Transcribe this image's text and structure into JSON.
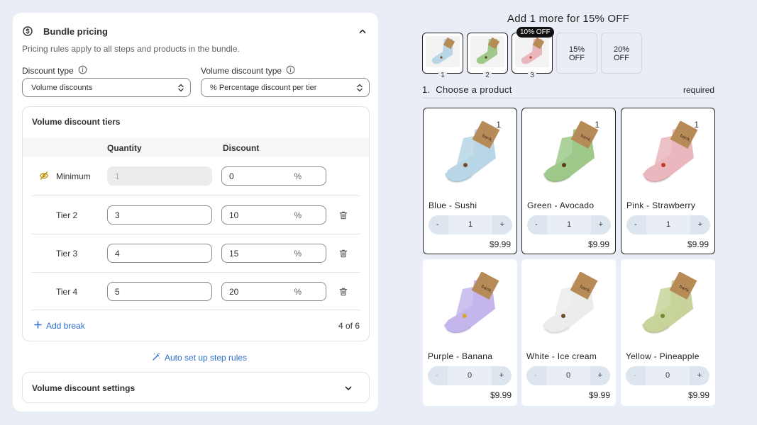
{
  "panel": {
    "title": "Bundle pricing",
    "description": "Pricing rules apply to all steps and products in the bundle.",
    "discount_type_label": "Discount type",
    "discount_type_value": "Volume discounts",
    "volume_type_label": "Volume discount type",
    "volume_type_value": "% Percentage discount per tier",
    "tiers_title": "Volume discount tiers",
    "col_quantity": "Quantity",
    "col_discount": "Discount",
    "tiers": [
      {
        "name": "Minimum",
        "quantity": "1",
        "discount": "0",
        "unit": "%"
      },
      {
        "name": "Tier 2",
        "quantity": "3",
        "discount": "10",
        "unit": "%"
      },
      {
        "name": "Tier 3",
        "quantity": "4",
        "discount": "15",
        "unit": "%"
      },
      {
        "name": "Tier 4",
        "quantity": "5",
        "discount": "20",
        "unit": "%"
      }
    ],
    "add_break": "Add break",
    "count": "4 of 6",
    "auto_setup": "Auto set up step rules",
    "settings_title": "Volume discount settings"
  },
  "preview": {
    "promo": "Add 1 more for 15% OFF",
    "slots": [
      {
        "num": "1",
        "color": "#b9d6e6"
      },
      {
        "num": "2",
        "color": "#9ec98a"
      },
      {
        "num": "3",
        "color": "#e9b7bd",
        "badge": "10% OFF"
      },
      {
        "label": "15%\nOFF"
      },
      {
        "label": "20%\nOFF"
      }
    ],
    "step_title": "1.  Choose a product",
    "step_required": "required",
    "products": [
      {
        "name": "Blue - Sushi",
        "qty": "1",
        "badge_qty": "1",
        "price": "$9.99",
        "color": "#b9d6e6"
      },
      {
        "name": "Green - Avocado",
        "qty": "1",
        "badge_qty": "1",
        "price": "$9.99",
        "color": "#9ec98a"
      },
      {
        "name": "Pink - Strawberry",
        "qty": "1",
        "badge_qty": "1",
        "price": "$9.99",
        "color": "#e9b7bd"
      },
      {
        "name": "Purple - Banana",
        "qty": "0",
        "price": "$9.99",
        "color": "#c4b6ec"
      },
      {
        "name": "White - Ice cream",
        "qty": "0",
        "price": "$9.99",
        "color": "#ececec"
      },
      {
        "name": "Yellow - Pineapple",
        "qty": "0",
        "price": "$9.99",
        "color": "#c7d39a"
      }
    ],
    "minus": "-",
    "plus": "+"
  }
}
